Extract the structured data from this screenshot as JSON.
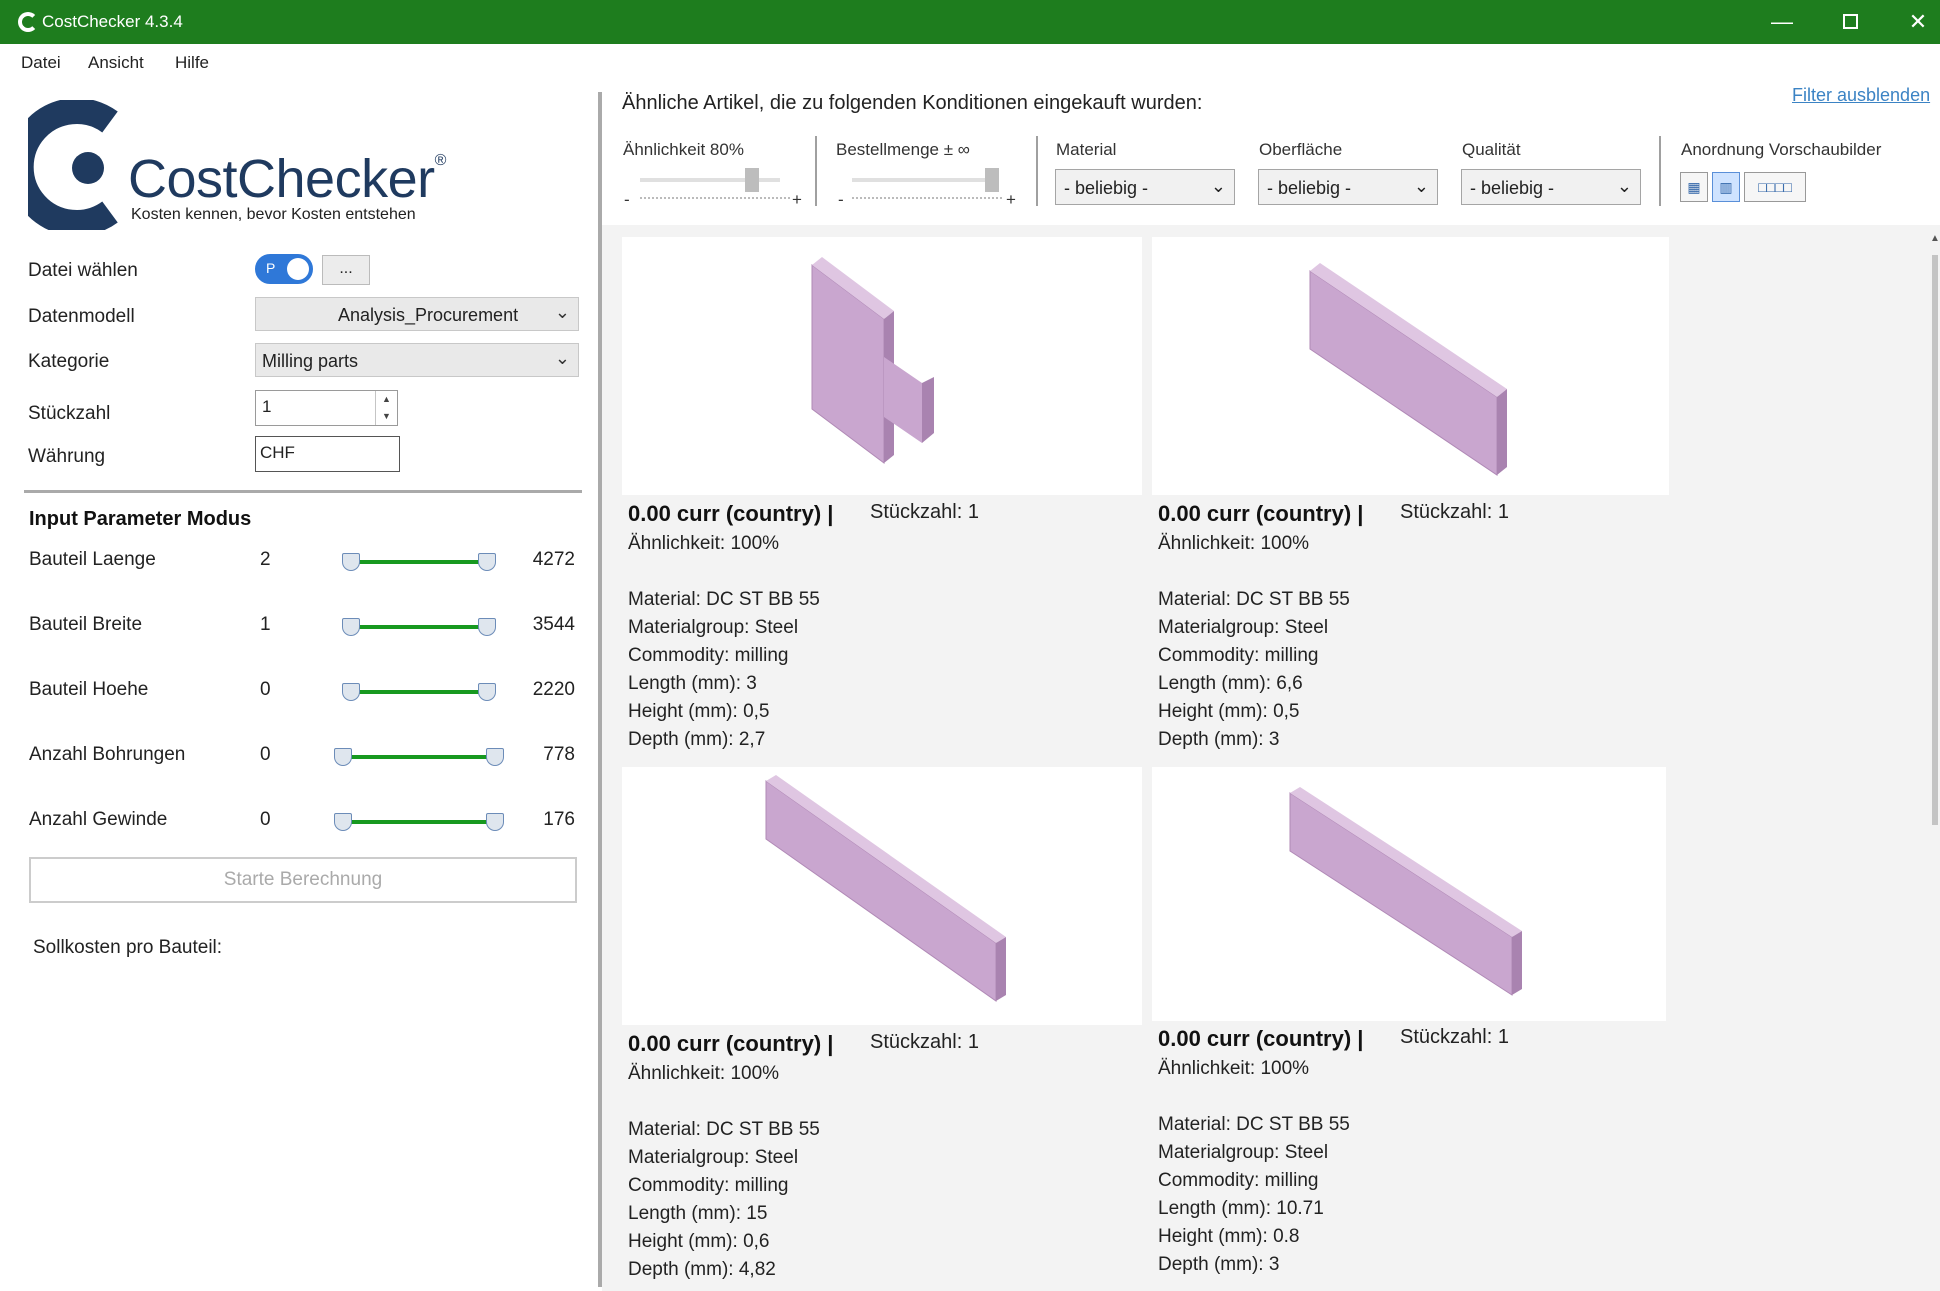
{
  "window": {
    "title": "CostChecker 4.3.4"
  },
  "menu": [
    "Datei",
    "Ansicht",
    "Hilfe"
  ],
  "logo": {
    "brand": "CostChecker",
    "reg": "®",
    "tagline": "Kosten kennen, bevor Kosten entstehen"
  },
  "form": {
    "file_label": "Datei wählen",
    "toggle_text": "P",
    "browse_label": "...",
    "model_label": "Datenmodell",
    "model_value": "Analysis_Procurement",
    "category_label": "Kategorie",
    "category_value": "Milling parts",
    "qty_label": "Stückzahl",
    "qty_value": "1",
    "currency_label": "Währung",
    "currency_value": "CHF"
  },
  "params": {
    "title": "Input Parameter Modus",
    "items": [
      {
        "label": "Bauteil Laenge",
        "min": "2",
        "max": "4272"
      },
      {
        "label": "Bauteil Breite",
        "min": "1",
        "max": "3544"
      },
      {
        "label": "Bauteil Hoehe",
        "min": "0",
        "max": "2220"
      },
      {
        "label": "Anzahl Bohrungen",
        "min": "0",
        "max": "778"
      },
      {
        "label": "Anzahl Gewinde",
        "min": "0",
        "max": "176"
      }
    ],
    "calc_button": "Starte Berechnung",
    "target_cost_label": "Sollkosten pro Bauteil:"
  },
  "filters": {
    "heading": "Ähnliche Artikel, die zu folgenden Konditionen eingekauft wurden:",
    "hide_link": "Filter ausblenden",
    "similarity_label": "Ähnlichkeit 80%",
    "similarity_value": 0.8,
    "order_qty_label": "Bestellmenge ± ∞",
    "order_qty_value": 1.0,
    "minus": "-",
    "plus": "+",
    "material_label": "Material",
    "material_value": "- beliebig -",
    "surface_label": "Oberfläche",
    "surface_value": "- beliebig -",
    "quality_label": "Qualität",
    "quality_value": "- beliebig -",
    "preview_label": "Anordnung Vorschaubilder"
  },
  "results": [
    {
      "price": "0.00 curr (country) |",
      "qty": "Stückzahl: 1",
      "similarity": "Ähnlichkeit: 100%",
      "material": "Material: DC ST BB 55",
      "materialgroup": "Materialgroup: Steel",
      "commodity": "Commodity: milling",
      "length": "Length (mm): 3",
      "height": "Height (mm): 0,5",
      "depth": "Depth (mm): 2,7"
    },
    {
      "price": "0.00 curr (country) |",
      "qty": "Stückzahl: 1",
      "similarity": "Ähnlichkeit: 100%",
      "material": "Material: DC ST BB 55",
      "materialgroup": "Materialgroup: Steel",
      "commodity": "Commodity: milling",
      "length": "Length (mm): 6,6",
      "height": "Height (mm): 0,5",
      "depth": "Depth (mm): 3"
    },
    {
      "price": "0.00 curr (country) |",
      "qty": "Stückzahl: 1",
      "similarity": "Ähnlichkeit: 100%",
      "material": "Material: DC ST BB 55",
      "materialgroup": "Materialgroup: Steel",
      "commodity": "Commodity: milling",
      "length": "Length (mm): 15",
      "height": "Height (mm): 0,6",
      "depth": "Depth (mm): 4,82"
    },
    {
      "price": "0.00 curr (country) |",
      "qty": "Stückzahl: 1",
      "similarity": "Ähnlichkeit: 100%",
      "material": "Material: DC ST BB 55",
      "materialgroup": "Materialgroup: Steel",
      "commodity": "Commodity: milling",
      "length": "Length (mm): 10.71",
      "height": "Height (mm): 0.8",
      "depth": "Depth (mm): 3"
    }
  ],
  "colors": {
    "titlebar": "#1e7d1e",
    "accent_green": "#17991f",
    "part": "#c9a6cf",
    "link": "#3b83c4"
  }
}
